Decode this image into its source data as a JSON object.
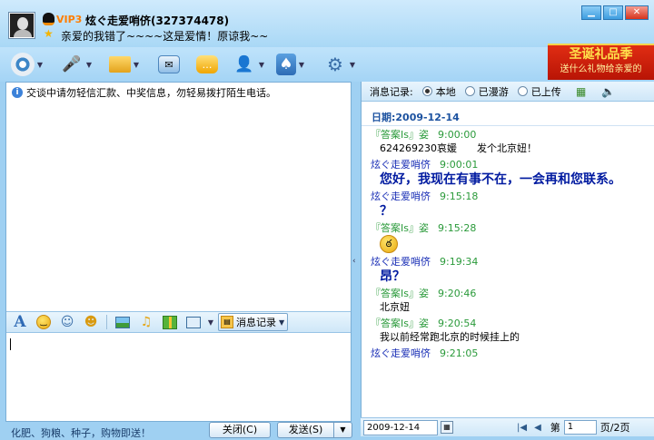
{
  "header": {
    "vip_label": "VIP3",
    "nickname": "炫ぐ走爱哨侪(327374478)",
    "signature": "亲爱的我错了~~~~这是爱情！原谅我~~"
  },
  "window_buttons": [
    "▁",
    "□",
    "✕"
  ],
  "toolbar": {
    "items": [
      {
        "name": "video-call",
        "icon": "webcam-icon"
      },
      {
        "name": "voice-call",
        "icon": "microphone-icon"
      },
      {
        "name": "send-file",
        "icon": "folder-icon"
      },
      {
        "name": "send-message-card",
        "icon": "envelope-icon"
      },
      {
        "name": "chat-bubble",
        "icon": "chat-icon"
      },
      {
        "name": "contact-info",
        "icon": "profile-icon"
      },
      {
        "name": "games",
        "icon": "cards-icon"
      },
      {
        "name": "app-settings",
        "icon": "gear-icon"
      }
    ],
    "promo_title": "圣诞礼品季",
    "promo_subtitle": "送什么礼物给亲爱的"
  },
  "notice": "交谈中请勿轻信汇款、中奖信息，勿轻易拨打陌生电话。",
  "input_toolbar": {
    "history_label": "消息记录"
  },
  "bottom": {
    "tip": "化肥、狗粮、种子，购物即送！",
    "close_label": "关闭(C)",
    "send_label": "发送(S)"
  },
  "history": {
    "label": "消息记录:",
    "options": [
      "本地",
      "已漫游",
      "已上传"
    ],
    "selected": "本地",
    "date_heading": "日期:2009-12-14",
    "messages": [
      {
        "sender": "『答案Is』姿",
        "time": "9:00:00",
        "text": "624269230哀媛　　发个北京妞！",
        "style": "plain",
        "self": false
      },
      {
        "sender": "炫ぐ走爱哨侪",
        "time": "9:00:01",
        "text": "您好，我现在有事不在，一会再和您联系。",
        "style": "bold",
        "self": true
      },
      {
        "sender": "炫ぐ走爱哨侪",
        "time": "9:15:18",
        "text": "？",
        "style": "bold",
        "self": true
      },
      {
        "sender": "『答案Is』姿",
        "time": "9:15:28",
        "text": "",
        "style": "smiley",
        "self": false
      },
      {
        "sender": "炫ぐ走爱哨侪",
        "time": "9:19:34",
        "text": "昂？",
        "style": "bold",
        "self": true
      },
      {
        "sender": "『答案Is』姿",
        "time": "9:20:46",
        "text": "北京妞",
        "style": "plain",
        "self": false
      },
      {
        "sender": "『答案Is』姿",
        "time": "9:20:54",
        "text": "我以前经常跑北京的时候挂上的",
        "style": "plain",
        "self": false
      },
      {
        "sender": "炫ぐ走爱哨侪",
        "time": "9:21:05",
        "text": "",
        "style": "plain",
        "self": true
      }
    ],
    "pager": {
      "date_value": "2009-12-14",
      "page_prefix": "第",
      "page_value": "1",
      "page_suffix": "页/2页"
    }
  },
  "colors": {
    "accent": "#1c52a0",
    "sender_other": "#2a9a3a",
    "sender_self": "#1a2fb6",
    "promo_red": "#c81a08"
  }
}
